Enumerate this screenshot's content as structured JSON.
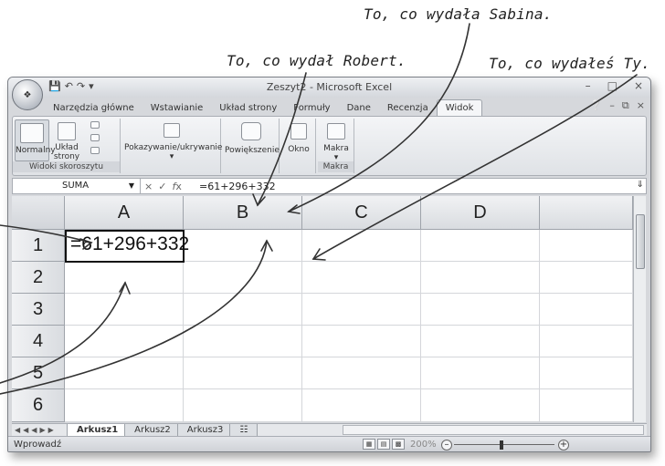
{
  "annotations": {
    "sabina": "To, co wydała Sabina.",
    "robert": "To, co wydał Robert.",
    "ty": "To, co wydałeś Ty."
  },
  "window": {
    "title": "Zeszyt2 - Microsoft Excel",
    "office_button": "Office",
    "tabs": [
      "Narzędzia główne",
      "Wstawianie",
      "Układ strony",
      "Formuły",
      "Dane",
      "Recenzja",
      "Widok"
    ],
    "active_tab": "Widok"
  },
  "ribbon": {
    "normal": "Normalny",
    "layout_1": "Układ",
    "layout_2": "strony",
    "show_hide": "Pokazywanie/ukrywanie",
    "zoom": "Powiększenie",
    "window_btn": "Okno",
    "macros": "Makra",
    "group_views": "Widoki skoroszytu",
    "group_macros": "Makra"
  },
  "formula_bar": {
    "name_box": "SUMA",
    "formula": "=61+296+332"
  },
  "grid": {
    "columns": [
      "A",
      "B",
      "C",
      "D"
    ],
    "rows": [
      "1",
      "2",
      "3",
      "4",
      "5",
      "6"
    ],
    "cell_a1": "=61+296+332"
  },
  "sheets": {
    "tabs": [
      "Arkusz1",
      "Arkusz2",
      "Arkusz3"
    ],
    "active": "Arkusz1"
  },
  "status": {
    "mode": "Wprowadź",
    "zoom": "200%"
  }
}
